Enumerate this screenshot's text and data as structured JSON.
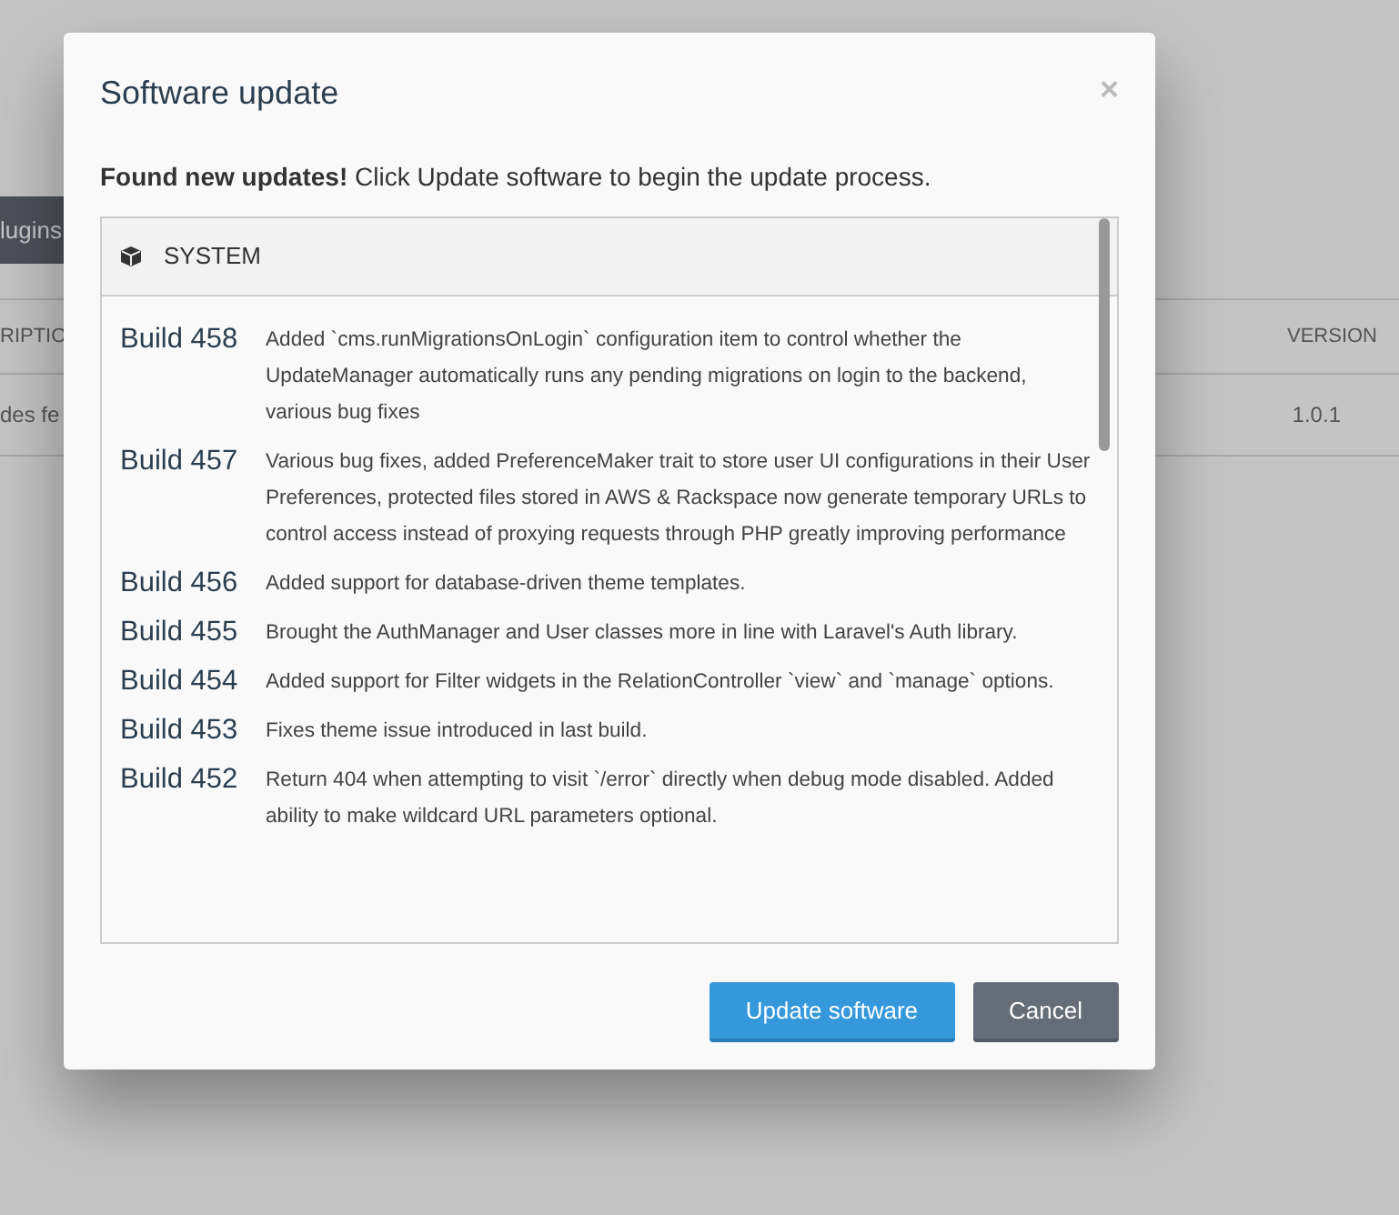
{
  "background": {
    "toolbar_button": "lugins",
    "table": {
      "columns": [
        "RIPTIO",
        "VERSION"
      ],
      "rows": [
        [
          "des fe",
          "1.0.1"
        ]
      ]
    }
  },
  "dialog": {
    "title": "Software update",
    "close": "×",
    "intro": "**Found new updates!** Click Update software to begin the update process.",
    "section": {
      "title": "SYSTEM",
      "builds": [
        {
          "build": "Build 458",
          "notes": "Added `cms.runMigrationsOnLogin` configuration item to control whether the UpdateManager automatically runs any pending migrations on login to the backend, various bug fixes"
        },
        {
          "build": "Build 457",
          "notes": "Various bug fixes, added PreferenceMaker trait to store user UI configurations in their User Preferences, protected files stored in AWS & Rackspace now generate temporary URLs to control access instead of proxying requests through PHP greatly improving performance"
        },
        {
          "build": "Build 456",
          "notes": "Added support for database-driven theme templates."
        },
        {
          "build": "Build 455",
          "notes": "Brought the AuthManager and User classes more in line with Laravel's Auth library."
        },
        {
          "build": "Build 454",
          "notes": "Added support for Filter widgets in the RelationController `view` and `manage` options."
        },
        {
          "build": "Build 453",
          "notes": "Fixes theme issue introduced in last build."
        },
        {
          "build": "Build 452",
          "notes": "Return 404 when attempting to visit `/error` directly when debug mode disabled. Added ability to make wildcard URL parameters optional."
        }
      ]
    },
    "buttons": [
      {
        "label": "Update software",
        "kind": "primary"
      },
      {
        "label": "Cancel",
        "kind": "secondary"
      }
    ]
  }
}
